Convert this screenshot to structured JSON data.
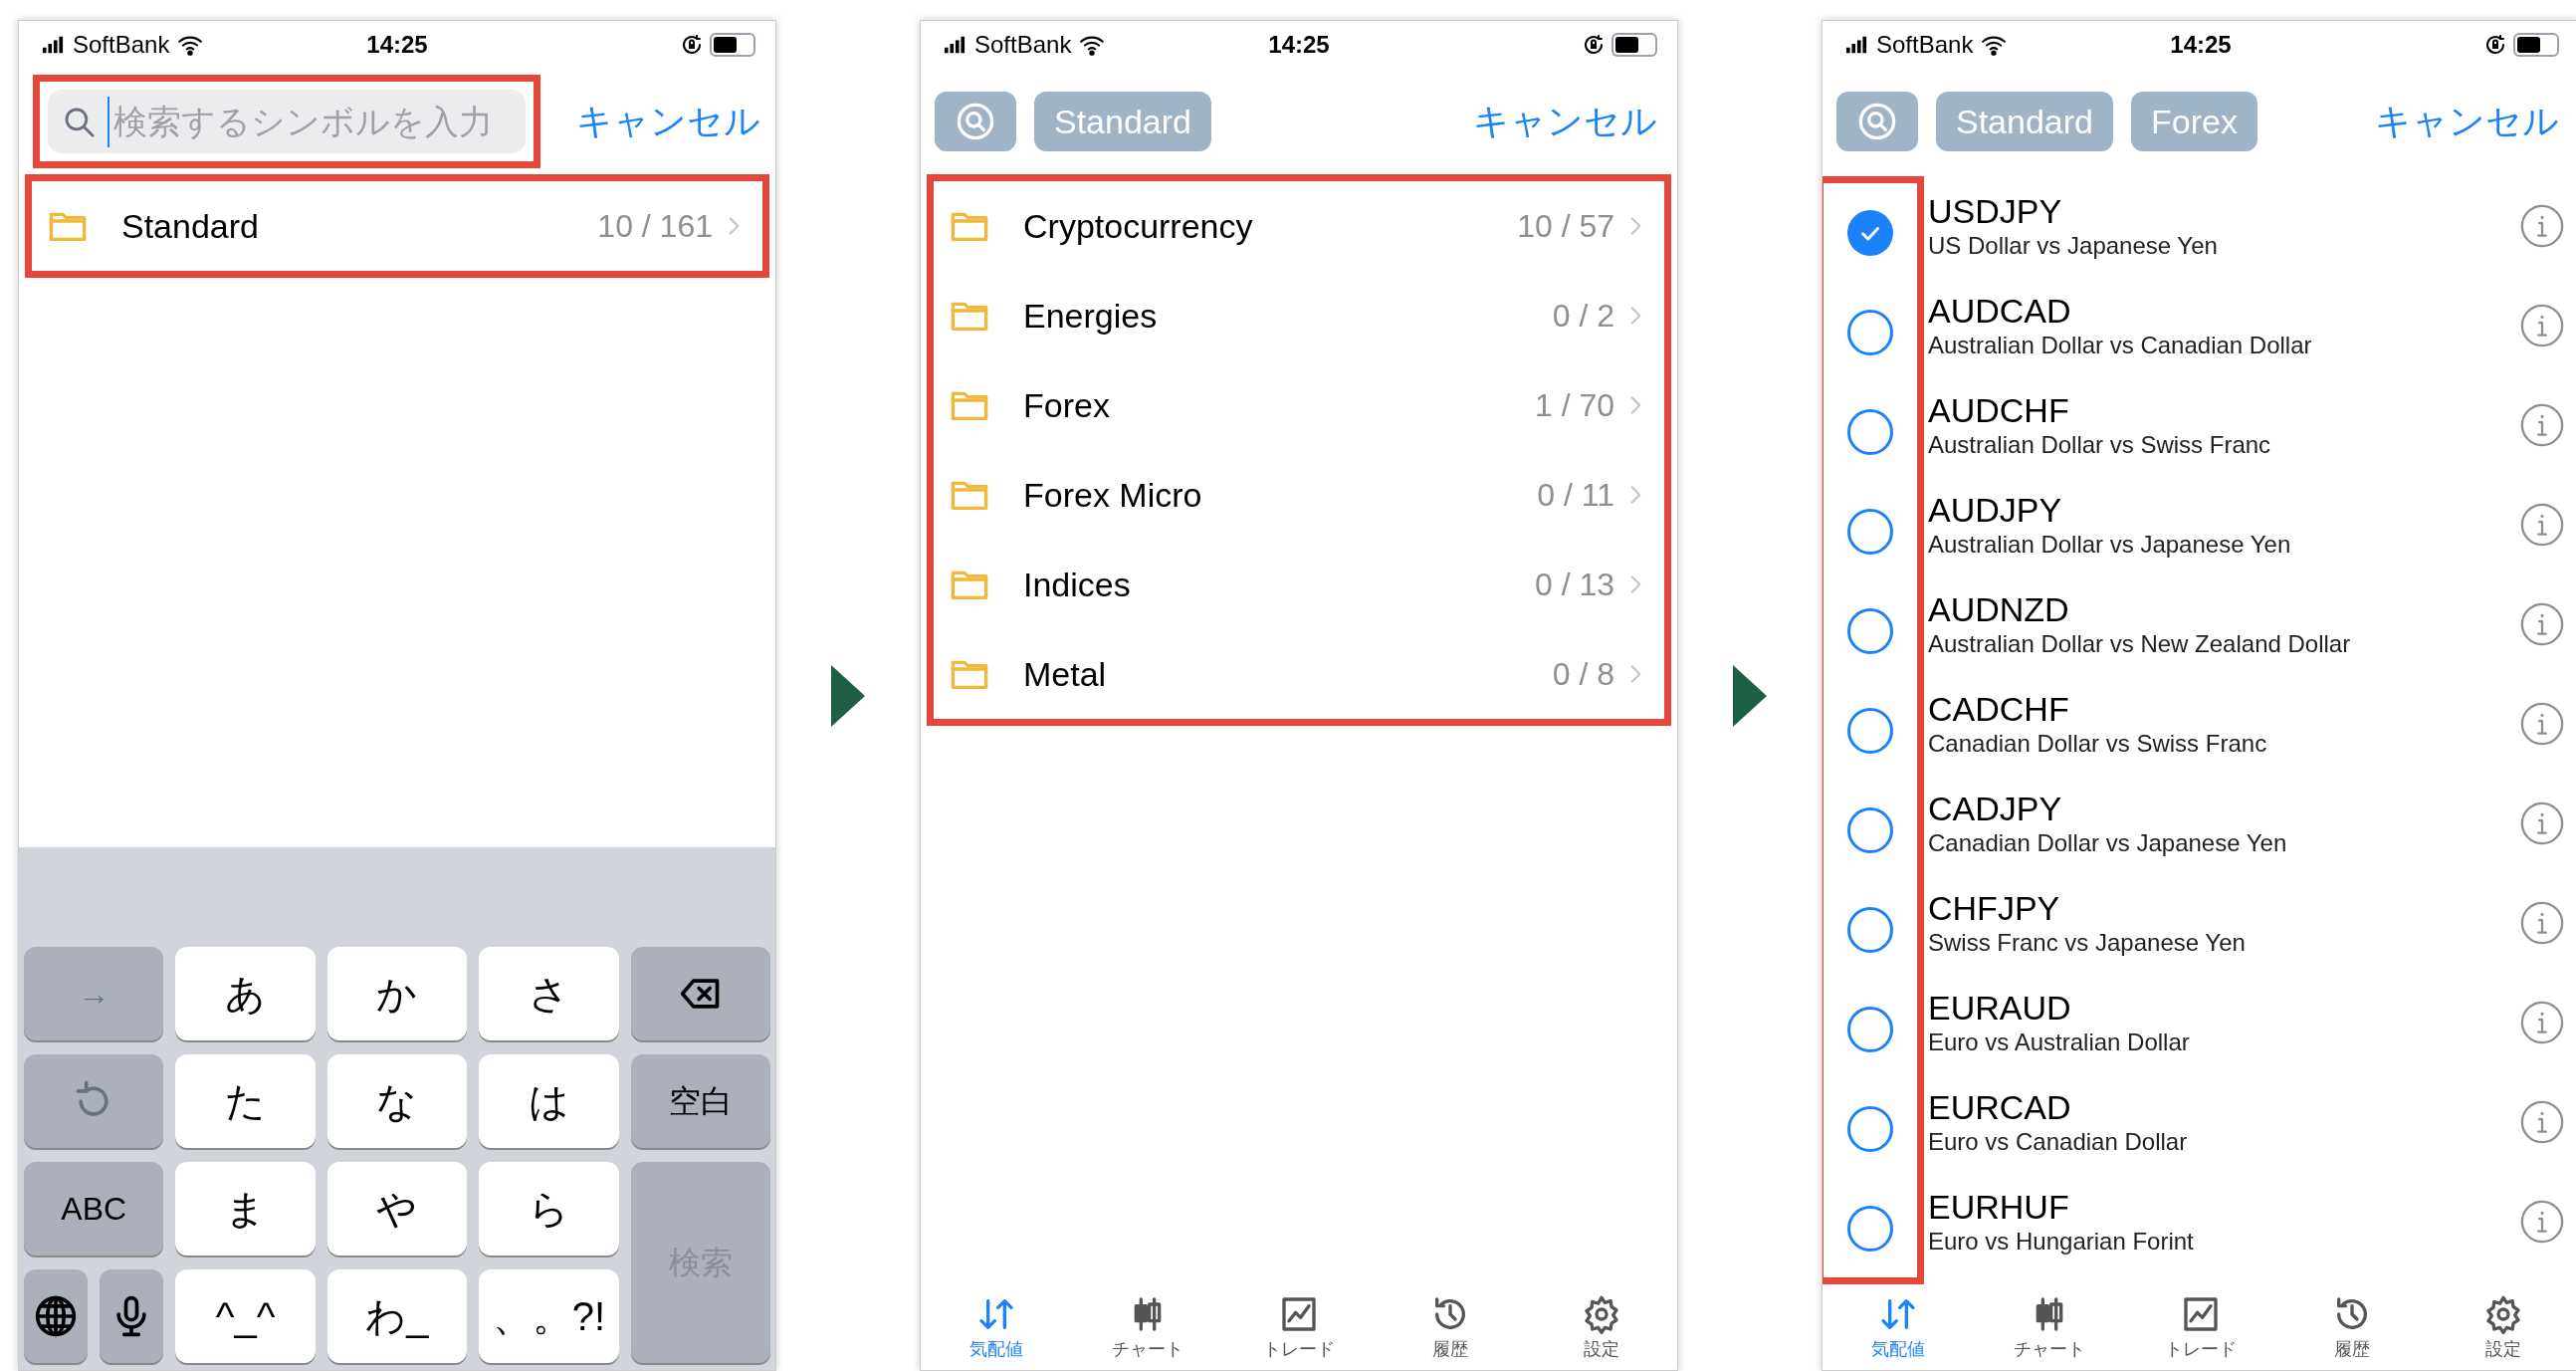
{
  "panels": [
    {
      "kind": "search",
      "status_bar": {
        "carrier": "SoftBank",
        "time": "14:25"
      },
      "search": {
        "placeholder": "検索するシンボルを入力",
        "highlighted": true
      },
      "cancel": "キャンセル",
      "folders": {
        "highlighted": true,
        "items": [
          {
            "name": "Standard",
            "count": "10 / 161"
          }
        ]
      },
      "keyboard": {
        "left": [
          {
            "kind": "text",
            "label": "→"
          },
          {
            "kind": "undo"
          },
          {
            "kind": "text",
            "label": "ABC"
          },
          {
            "kind": "globe"
          },
          {
            "kind": "mic"
          }
        ],
        "kana": [
          "あ",
          "か",
          "さ",
          "た",
          "な",
          "は",
          "ま",
          "や",
          "ら",
          "^_^",
          "わ_",
          "、。?!"
        ],
        "right": [
          {
            "kind": "backspace"
          },
          {
            "kind": "text",
            "label": "空白",
            "disabled": false
          },
          {
            "kind": "text",
            "label": "検索",
            "disabled": true
          }
        ]
      }
    },
    {
      "kind": "folders",
      "status_bar": {
        "carrier": "SoftBank",
        "time": "14:25"
      },
      "chips": [
        "Standard"
      ],
      "cancel": "キャンセル",
      "folders": {
        "highlighted": true,
        "items": [
          {
            "name": "Cryptocurrency",
            "count": "10 / 57"
          },
          {
            "name": "Energies",
            "count": "0 / 2"
          },
          {
            "name": "Forex",
            "count": "1 / 70"
          },
          {
            "name": "Forex Micro",
            "count": "0 / 11"
          },
          {
            "name": "Indices",
            "count": "0 / 13"
          },
          {
            "name": "Metal",
            "count": "0 / 8"
          }
        ]
      },
      "tab_bar": [
        {
          "label": "気配値",
          "selected": true
        },
        {
          "label": "チャート",
          "selected": false
        },
        {
          "label": "トレード",
          "selected": false
        },
        {
          "label": "履歴",
          "selected": false
        },
        {
          "label": "設定",
          "selected": false
        }
      ]
    },
    {
      "kind": "symbols",
      "status_bar": {
        "carrier": "SoftBank",
        "time": "14:25"
      },
      "chips": [
        "Standard",
        "Forex"
      ],
      "cancel": "キャンセル",
      "symbols": {
        "highlighted": true,
        "items": [
          {
            "symbol": "USDJPY",
            "description": "US Dollar vs Japanese Yen",
            "checked": true
          },
          {
            "symbol": "AUDCAD",
            "description": "Australian Dollar vs Canadian Dollar",
            "checked": false
          },
          {
            "symbol": "AUDCHF",
            "description": "Australian Dollar vs Swiss Franc",
            "checked": false
          },
          {
            "symbol": "AUDJPY",
            "description": "Australian Dollar vs Japanese Yen",
            "checked": false
          },
          {
            "symbol": "AUDNZD",
            "description": "Australian Dollar vs New Zealand Dollar",
            "checked": false
          },
          {
            "symbol": "CADCHF",
            "description": "Canadian Dollar vs Swiss Franc",
            "checked": false
          },
          {
            "symbol": "CADJPY",
            "description": "Canadian Dollar vs Japanese Yen",
            "checked": false
          },
          {
            "symbol": "CHFJPY",
            "description": "Swiss Franc vs Japanese Yen",
            "checked": false
          },
          {
            "symbol": "EURAUD",
            "description": "Euro vs Australian Dollar",
            "checked": false
          },
          {
            "symbol": "EURCAD",
            "description": "Euro vs Canadian Dollar",
            "checked": false
          },
          {
            "symbol": "EURHUF",
            "description": "Euro vs Hungarian Forint",
            "checked": false
          }
        ]
      },
      "tab_bar": [
        {
          "label": "気配値",
          "selected": true
        },
        {
          "label": "チャート",
          "selected": false
        },
        {
          "label": "トレード",
          "selected": false
        },
        {
          "label": "履歴",
          "selected": false
        },
        {
          "label": "設定",
          "selected": false
        }
      ]
    }
  ]
}
